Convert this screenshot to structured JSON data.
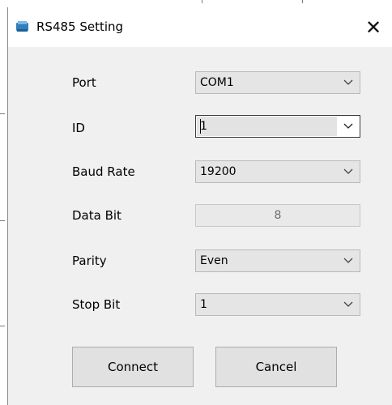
{
  "window": {
    "title": "RS485 Setting",
    "close_glyph": "✕",
    "app_icon": "serial-port-icon"
  },
  "fields": {
    "port": {
      "label": "Port",
      "value": "COM1"
    },
    "id": {
      "label": "ID",
      "value": "1"
    },
    "baud_rate": {
      "label": "Baud Rate",
      "value": "19200"
    },
    "data_bit": {
      "label": "Data Bit",
      "value": "8"
    },
    "parity": {
      "label": "Parity",
      "value": "Even"
    },
    "stop_bit": {
      "label": "Stop Bit",
      "value": "1"
    }
  },
  "buttons": {
    "connect": "Connect",
    "cancel": "Cancel"
  },
  "colors": {
    "client_bg": "#f0f0f0",
    "title_bg": "#ffffff",
    "combo_bg": "#e5e5e5",
    "button_bg": "#e1e1e1",
    "icon_blue": "#2f7fbf"
  }
}
